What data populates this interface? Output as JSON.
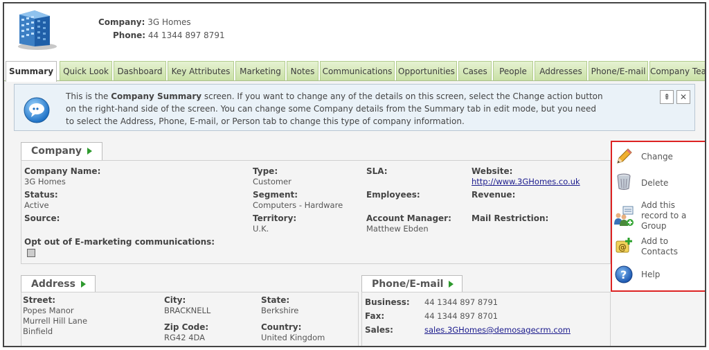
{
  "header": {
    "company_label": "Company:",
    "company_value": "3G Homes",
    "phone_label": "Phone:",
    "phone_value": "44 1344 897 8791",
    "logo_icon": "building-icon"
  },
  "tabs": [
    {
      "label": "Summary"
    },
    {
      "label": "Quick Look"
    },
    {
      "label": "Dashboard"
    },
    {
      "label": "Key Attributes"
    },
    {
      "label": "Marketing"
    },
    {
      "label": "Notes"
    },
    {
      "label": "Communications"
    },
    {
      "label": "Opportunities"
    },
    {
      "label": "Cases"
    },
    {
      "label": "People"
    },
    {
      "label": "Addresses"
    },
    {
      "label": "Phone/E-mail"
    },
    {
      "label": "Company Tea"
    }
  ],
  "info": {
    "pre": "This is the ",
    "bold": "Company Summary",
    "post": " screen. If you want to change any of the details on this screen, select the Change action button on the right-hand side of the screen. You can change some Company details from the Summary tab in edit mode, but you need to select the Address, Phone, E-mail, or Person tab to change this type of company information.",
    "icon": "speech-bubble-icon",
    "btn_pin": "⇞",
    "btn_close": "✕"
  },
  "company": {
    "tab": "Company",
    "fields": {
      "company_name_label": "Company Name:",
      "company_name_value": "3G Homes",
      "status_label": "Status:",
      "status_value": "Active",
      "source_label": "Source:",
      "type_label": "Type:",
      "type_value": "Customer",
      "segment_label": "Segment:",
      "segment_value": "Computers - Hardware",
      "territory_label": "Territory:",
      "territory_value": "U.K.",
      "sla_label": "SLA:",
      "employees_label": "Employees:",
      "account_manager_label": "Account Manager:",
      "account_manager_value": "Matthew Ebden",
      "website_label": "Website:",
      "website_value": "http://www.3GHomes.co.uk",
      "revenue_label": "Revenue:",
      "mail_restriction_label": "Mail Restriction:",
      "opt_out_label": "Opt out of E-marketing communications:"
    }
  },
  "address": {
    "tab": "Address",
    "street_label": "Street:",
    "street_lines": [
      "Popes Manor",
      "Murrell Hill Lane",
      "Binfield"
    ],
    "city_label": "City:",
    "city_value": "BRACKNELL",
    "zip_label": "Zip Code:",
    "zip_value": "RG42 4DA",
    "state_label": "State:",
    "state_value": "Berkshire",
    "country_label": "Country:",
    "country_value": "United Kingdom"
  },
  "phone_email": {
    "tab": "Phone/E-mail",
    "business_label": "Business:",
    "business_value": "44 1344 897 8791",
    "fax_label": "Fax:",
    "fax_value": "44 1344 897 8701",
    "sales_label": "Sales:",
    "sales_value": "sales.3GHomes@demosagecrm.com"
  },
  "actions": [
    {
      "label": "Change",
      "icon": "pencil-icon"
    },
    {
      "label": "Delete",
      "icon": "trash-icon"
    },
    {
      "label": "Add this record to a Group",
      "lines": [
        "Add this",
        "record to a",
        "Group"
      ],
      "icon": "group-add-icon"
    },
    {
      "label": "Add to Contacts",
      "lines": [
        "Add to",
        "Contacts"
      ],
      "icon": "contact-card-add-icon"
    },
    {
      "label": "Help",
      "icon": "help-icon"
    }
  ],
  "colors": {
    "tab_green": "#c9e0a6",
    "action_border": "#dd2222",
    "link": "#1a1a8c",
    "arrow": "#2e9a2e"
  }
}
